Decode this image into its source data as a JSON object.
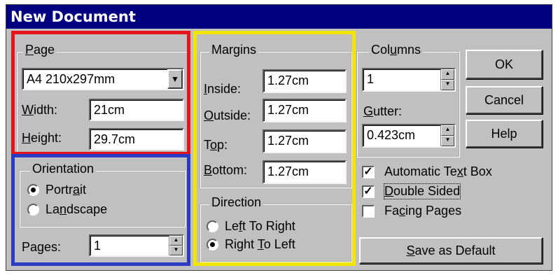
{
  "window": {
    "title": "New Document"
  },
  "page": {
    "group_title": "Page",
    "size_value": "A4 210x297mm",
    "width_label": "Width:",
    "width_value": "21cm",
    "height_label": "Height:",
    "height_value": "29.7cm"
  },
  "orientation": {
    "group_title": "Orientation",
    "portrait_label": "Portrait",
    "landscape_label": "Landscape",
    "selected": "Portrait",
    "pages_label": "Pages:",
    "pages_value": "1"
  },
  "margins": {
    "group_title": "Margins",
    "inside_label": "Inside:",
    "inside_value": "1.27cm",
    "outside_label": "Outside:",
    "outside_value": "1.27cm",
    "top_label": "Top:",
    "top_value": "1.27cm",
    "bottom_label": "Bottom:",
    "bottom_value": "1.27cm"
  },
  "direction": {
    "group_title": "Direction",
    "ltr_label": "Left To Right",
    "rtl_label": "Right To Left",
    "selected": "Right To Left"
  },
  "columns": {
    "group_title": "Columns",
    "columns_value": "1",
    "gutter_label": "Gutter:",
    "gutter_value": "0.423cm"
  },
  "buttons": {
    "ok": "OK",
    "cancel": "Cancel",
    "help": "Help",
    "save_default": "Save as Default"
  },
  "options": {
    "automatic_text_box": {
      "label": "Automatic Text Box",
      "checked": true
    },
    "double_sided": {
      "label": "Double Sided",
      "checked": true
    },
    "facing_pages": {
      "label": "Facing Pages",
      "checked": false
    }
  },
  "colors": {
    "titlebar": "#000080",
    "highlight_page": "#e8141c",
    "highlight_orientation": "#2b3cc4",
    "highlight_margins": "#f2e600"
  }
}
